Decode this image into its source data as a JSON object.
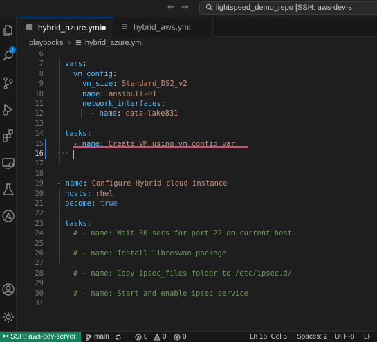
{
  "window": {
    "title": "lightspeed_demo_repo [SSH: aws-dev-s",
    "back_arrow": "←",
    "forward_arrow": "→"
  },
  "activity_bar": {
    "explorer_badge": "1",
    "icons": [
      "files-icon",
      "search-icon",
      "source-control-icon",
      "run-debug-icon",
      "extensions-icon",
      "remote-explorer-icon",
      "testing-icon",
      "ansible-icon",
      "account-icon",
      "settings-gear-icon"
    ]
  },
  "tabs": [
    {
      "label": "hybrid_azure.yml",
      "active": true,
      "dirty": true
    },
    {
      "label": "hybrid_aws.yml",
      "active": false,
      "dirty": false
    }
  ],
  "breadcrumb": {
    "folder": "playbooks",
    "separator": ">",
    "file": "hybrid_azure.yml"
  },
  "editor": {
    "lines": [
      {
        "n": "6",
        "code": ""
      },
      {
        "n": "7",
        "code": "vars:"
      },
      {
        "n": "8",
        "code": "vm_config:"
      },
      {
        "n": "9",
        "code": "vm_size: Standard_DS2_v2"
      },
      {
        "n": "10",
        "code": "name: ansibull-01"
      },
      {
        "n": "11",
        "code": "network_interfaces:"
      },
      {
        "n": "12",
        "code": "- name: data-lake831"
      },
      {
        "n": "13",
        "code": ""
      },
      {
        "n": "14",
        "code": "tasks:"
      },
      {
        "n": "15",
        "code": "- name: Create VM using vm_config var"
      },
      {
        "n": "16",
        "code": ""
      },
      {
        "n": "17",
        "code": ""
      },
      {
        "n": "18",
        "code": ""
      },
      {
        "n": "19",
        "code": "- name: Configure Hybrid cloud instance"
      },
      {
        "n": "20",
        "code": "hosts: rhel"
      },
      {
        "n": "21",
        "code": "become: true"
      },
      {
        "n": "22",
        "code": ""
      },
      {
        "n": "23",
        "code": "tasks:"
      },
      {
        "n": "24",
        "code": "# - name: Wait 30 secs for port 22 on current host"
      },
      {
        "n": "25",
        "code": ""
      },
      {
        "n": "26",
        "code": "# - name: Install libreswan package"
      },
      {
        "n": "27",
        "code": ""
      },
      {
        "n": "28",
        "code": "# - name: Copy ipsec_files folder to /etc/ipsec.d/"
      },
      {
        "n": "29",
        "code": ""
      },
      {
        "n": "30",
        "code": "# - name: Start and enable ipsec service"
      },
      {
        "n": "31",
        "code": ""
      }
    ],
    "ghost_dots": "···"
  },
  "statusbar": {
    "remote": "SSH: aws-dev-server",
    "branch": "main",
    "errors": "0",
    "warnings": "0",
    "ports": "0",
    "position": "Ln 16, Col 5",
    "spaces": "Spaces: 2",
    "encoding": "UTF-8",
    "eol": "LF"
  },
  "colors": {
    "accent": "#0078d4",
    "remote_bg": "#16825d",
    "underline": "#e0457b",
    "key": "#4fc1ff",
    "string": "#ce9178",
    "boolean": "#569cd6",
    "comment": "#6a9955"
  }
}
